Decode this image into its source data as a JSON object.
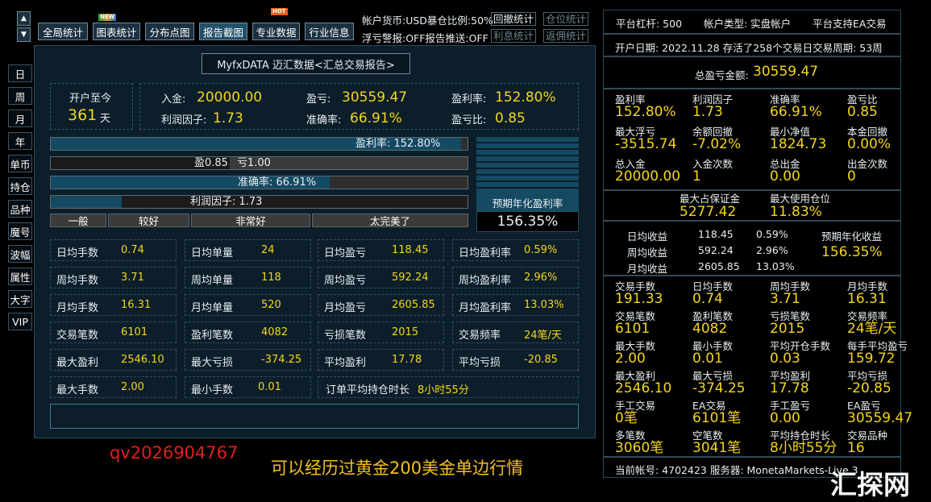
{
  "toolbar": {
    "buttons": [
      "全局统计",
      "图表统计",
      "分布点图",
      "报告截图",
      "专业数据",
      "行业信息"
    ],
    "new_badge": "NEW",
    "hot_badge": "HOT",
    "currency_line": "帐户货币:USD暴仓比例:50%",
    "alert_line": "浮亏警报:OFF报告推送:OFF",
    "links": [
      "回撤统计",
      "仓位统计",
      "利息统计",
      "返佣统计"
    ]
  },
  "side_tabs": [
    "日",
    "周",
    "月",
    "年",
    "单币",
    "持仓",
    "品种",
    "魔号",
    "波幅",
    "属性",
    "大字",
    "VIP"
  ],
  "report": {
    "title": "MyfxDATA 迈汇数据<汇总交易报告>",
    "open_label": "开户至今",
    "open_days": "361",
    "open_unit": "天",
    "deposit_label": "入金:",
    "deposit": "20000.00",
    "pnl_label": "盈亏:",
    "pnl": "30559.47",
    "roi_label": "盈利率:",
    "roi": "152.80%",
    "pf_label": "利润因子:",
    "pf": "1.73",
    "acc_label": "准确率:",
    "acc": "66.91%",
    "ratio_label": "盈亏比:",
    "ratio": "0.85",
    "bar_roi": "盈利率: 152.80%",
    "bar_win": "盈0.85",
    "bar_loss": "亏1.00",
    "bar_acc": "准确率: 66.91%",
    "bar_pf": "利润因子: 1.73",
    "bar_levels": {
      "roi": 0.985,
      "win": 0.43,
      "acc": 0.6691,
      "pf": 0.17
    },
    "grades": [
      "一般",
      "较好",
      "非常好",
      "太完美了"
    ],
    "annual_label": "预期年化盈利率",
    "annual": "156.35%",
    "grid": [
      [
        [
          "日均手数",
          "0.74"
        ],
        [
          "日均单量",
          "24"
        ],
        [
          "日均盈亏",
          "118.45"
        ],
        [
          "日均盈利率",
          "0.59%"
        ]
      ],
      [
        [
          "周均手数",
          "3.71"
        ],
        [
          "周均单量",
          "118"
        ],
        [
          "周均盈亏",
          "592.24"
        ],
        [
          "周均盈利率",
          "2.96%"
        ]
      ],
      [
        [
          "月均手数",
          "16.31"
        ],
        [
          "月均单量",
          "520"
        ],
        [
          "月均盈亏",
          "2605.85"
        ],
        [
          "月均盈利率",
          "13.03%"
        ]
      ],
      [
        [
          "交易笔数",
          "6101"
        ],
        [
          "盈利笔数",
          "4082"
        ],
        [
          "亏损笔数",
          "2015"
        ],
        [
          "交易频率",
          "24笔/天"
        ]
      ],
      [
        [
          "最大盈利",
          "2546.10"
        ],
        [
          "最大亏损",
          "-374.25"
        ],
        [
          "平均盈利",
          "17.78"
        ],
        [
          "平均亏损",
          "-20.85"
        ]
      ]
    ],
    "last_row": [
      [
        "最大手数",
        "2.00"
      ],
      [
        "最小手数",
        "0.01"
      ]
    ],
    "hold_label": "订单平均持仓时长",
    "hold": "8小时55分"
  },
  "watermark": {
    "qq": "qv2026904767",
    "slogan": "可以经历过黄金200美金单边行情",
    "brand": "汇探网"
  },
  "right": {
    "leverage": "平台杠杆: 500",
    "acct_type": "帐户类型: 实盘帐户",
    "ea": "平台支持EA交易",
    "open_info": "开户日期: 2022.11.28 存活了258个交易日交易周期: 53周",
    "total_label": "总盈亏金额:",
    "total": "30559.47",
    "grid1": [
      [
        [
          "盈利率",
          "152.80%"
        ],
        [
          "利润因子",
          "1.73"
        ],
        [
          "准确率",
          "66.91%"
        ],
        [
          "盈亏比",
          "0.85"
        ]
      ],
      [
        [
          "最大浮亏",
          "-3515.74"
        ],
        [
          "余额回撤",
          "-7.02%"
        ],
        [
          "最小净值",
          "1824.73"
        ],
        [
          "本金回撤",
          "0.00%"
        ]
      ],
      [
        [
          "总入金",
          "20000.00"
        ],
        [
          "入金次数",
          "1"
        ],
        [
          "总出金",
          "0.00"
        ],
        [
          "出金次数",
          "0"
        ]
      ]
    ],
    "margin": [
      [
        "最大占保证金",
        "5277.42"
      ],
      [
        "最大使用仓位",
        "11.83%"
      ]
    ],
    "income": [
      [
        "日均收益",
        "118.45",
        "0.59%"
      ],
      [
        "周均收益",
        "592.24",
        "2.96%"
      ],
      [
        "月均收益",
        "2605.85",
        "13.03%"
      ]
    ],
    "annual_label": "预期年化收益",
    "annual": "156.35%",
    "grid2": [
      [
        [
          "交易手数",
          "191.33"
        ],
        [
          "日均手数",
          "0.74"
        ],
        [
          "周均手数",
          "3.71"
        ],
        [
          "月均手数",
          "16.31"
        ]
      ],
      [
        [
          "交易笔数",
          "6101"
        ],
        [
          "盈利笔数",
          "4082"
        ],
        [
          "亏损笔数",
          "2015"
        ],
        [
          "交易频率",
          "24笔/天"
        ]
      ],
      [
        [
          "最大手数",
          "2.00"
        ],
        [
          "最小手数",
          "0.01"
        ],
        [
          "平均开仓手数",
          "0.03"
        ],
        [
          "每手平均盈亏",
          "159.72"
        ]
      ],
      [
        [
          "最大盈利",
          "2546.10"
        ],
        [
          "最大亏损",
          "-374.25"
        ],
        [
          "平均盈利",
          "17.78"
        ],
        [
          "平均亏损",
          "-20.85"
        ]
      ],
      [
        [
          "手工交易",
          "0笔"
        ],
        [
          "EA交易",
          "6101笔"
        ],
        [
          "手工盈亏",
          "0.00"
        ],
        [
          "EA盈亏",
          "30559.47"
        ]
      ],
      [
        [
          "多笔数",
          "3060笔"
        ],
        [
          "空笔数",
          "3041笔"
        ],
        [
          "平均持仓时长",
          "8小时55分"
        ],
        [
          "交易品种",
          "16"
        ]
      ]
    ],
    "footer": "当前帐号: 4702423 服务器: MonetaMarkets-Live 3"
  },
  "colors": {
    "accent": "#f4d61a",
    "panel_bg": "#0c1e2a",
    "bar_fill": "#154a63"
  }
}
